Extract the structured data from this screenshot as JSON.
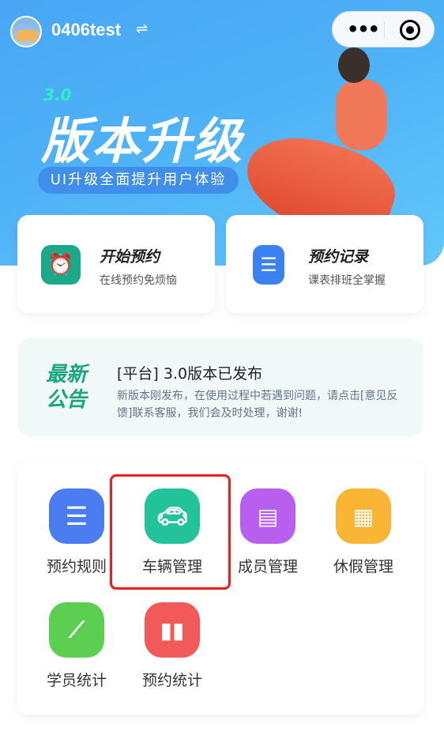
{
  "header": {
    "username": "0406test",
    "switch_icon": "swap-icon",
    "menu_icon": "more-dots-icon",
    "close_icon": "target-icon"
  },
  "banner": {
    "version": "3.0",
    "title": "版本升级",
    "subtitle": "UI升级全面提升用户体验"
  },
  "quick_actions": [
    {
      "title": "开始预约",
      "subtitle": "在线预约免烦恼",
      "icon": "alarm-clock-icon",
      "color": "#1ca98a"
    },
    {
      "title": "预约记录",
      "subtitle": "课表排班全掌握",
      "icon": "clipboard-icon",
      "color": "#3b82f0"
    }
  ],
  "notice": {
    "tag": "最新公告",
    "title": "[平台] 3.0版本已发布",
    "text": "新版本刚发布，在使用过程中若遇到问题，请点击[意见反馈]联系客服，我们会及时处理，谢谢!"
  },
  "menu": [
    {
      "label": "预约规则",
      "icon": "list-icon",
      "color": "#4b7df0"
    },
    {
      "label": "车辆管理",
      "icon": "car-icon",
      "color": "#22c39a"
    },
    {
      "label": "成员管理",
      "icon": "id-card-icon",
      "color": "#b85ff0"
    },
    {
      "label": "休假管理",
      "icon": "calendar-icon",
      "color": "#fbb534"
    },
    {
      "label": "学员统计",
      "icon": "line-chart-icon",
      "color": "#5ccf52"
    },
    {
      "label": "预约统计",
      "icon": "bar-chart-icon",
      "color": "#f25a5a"
    }
  ],
  "highlight_color": "#f01c1c"
}
